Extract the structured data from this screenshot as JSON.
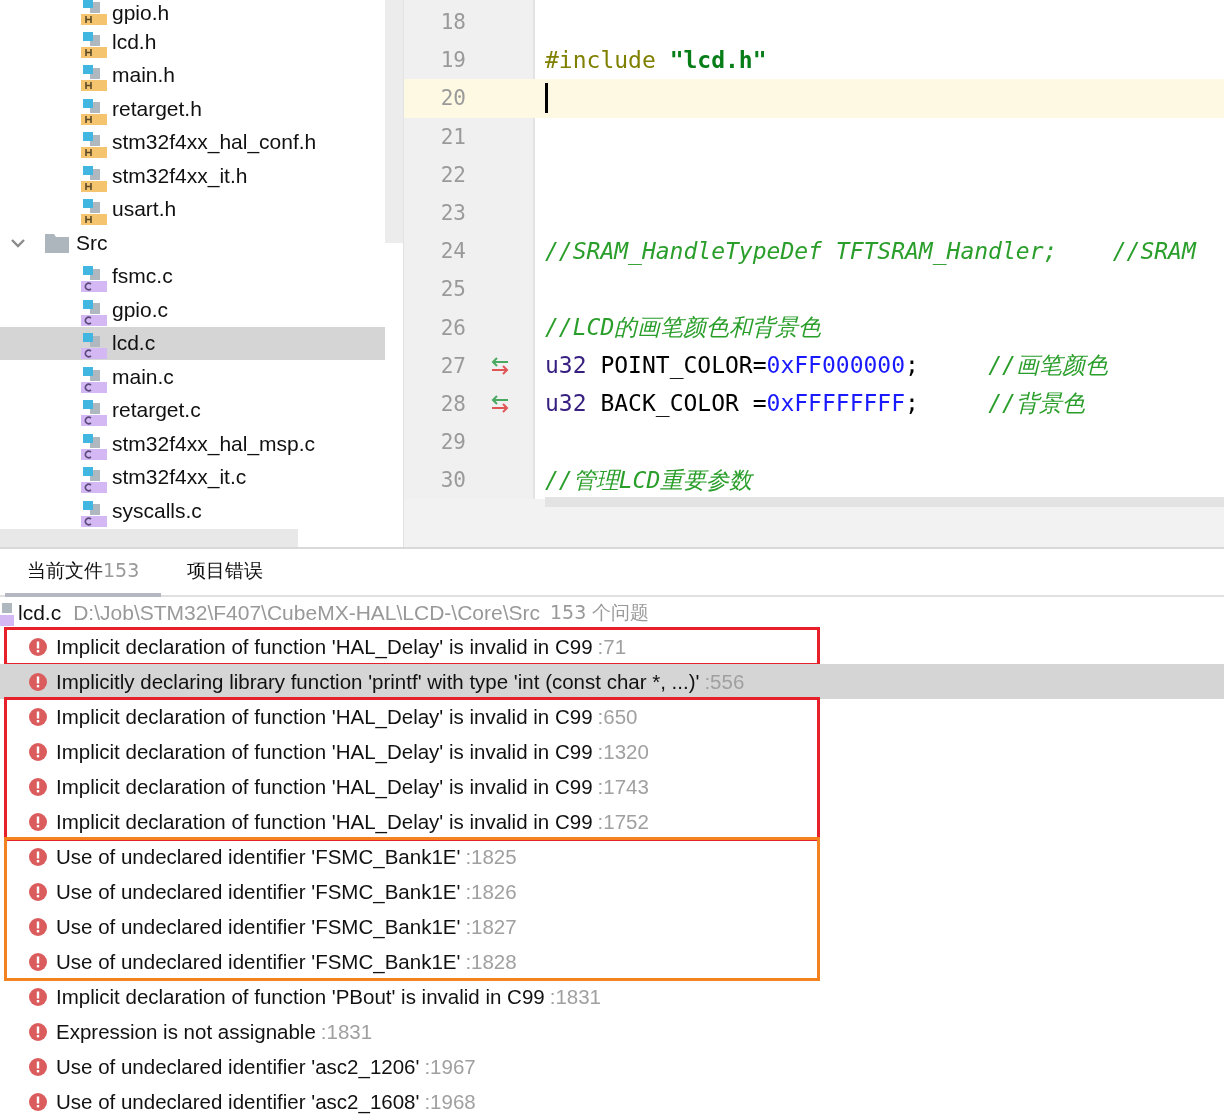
{
  "file_tree": {
    "items": [
      {
        "name": "gpio.h",
        "kind": "header",
        "selected": false
      },
      {
        "name": "lcd.h",
        "kind": "header",
        "selected": false
      },
      {
        "name": "main.h",
        "kind": "header",
        "selected": false
      },
      {
        "name": "retarget.h",
        "kind": "header",
        "selected": false
      },
      {
        "name": "stm32f4xx_hal_conf.h",
        "kind": "header",
        "selected": false
      },
      {
        "name": "stm32f4xx_it.h",
        "kind": "header",
        "selected": false
      },
      {
        "name": "usart.h",
        "kind": "header",
        "selected": false
      },
      {
        "name": "Src",
        "kind": "folder",
        "expanded": true,
        "selected": false,
        "children": [
          {
            "name": "fsmc.c",
            "kind": "source",
            "selected": false
          },
          {
            "name": "gpio.c",
            "kind": "source",
            "selected": false
          },
          {
            "name": "lcd.c",
            "kind": "source",
            "selected": true
          },
          {
            "name": "main.c",
            "kind": "source",
            "selected": false
          },
          {
            "name": "retarget.c",
            "kind": "source",
            "selected": false
          },
          {
            "name": "stm32f4xx_hal_msp.c",
            "kind": "source",
            "selected": false
          },
          {
            "name": "stm32f4xx_it.c",
            "kind": "source",
            "selected": false
          },
          {
            "name": "syscalls.c",
            "kind": "source",
            "selected": false
          }
        ]
      }
    ]
  },
  "editor": {
    "lines": [
      {
        "number": "18",
        "current": false,
        "changed": false
      },
      {
        "number": "19",
        "current": false,
        "changed": false,
        "tokens": [
          {
            "kind": "preproc",
            "text": "#include "
          },
          {
            "kind": "string",
            "text": "\"lcd.h\""
          }
        ]
      },
      {
        "number": "20",
        "current": true,
        "changed": false
      },
      {
        "number": "21",
        "current": false,
        "changed": false
      },
      {
        "number": "22",
        "current": false,
        "changed": false
      },
      {
        "number": "23",
        "current": false,
        "changed": false
      },
      {
        "number": "24",
        "current": false,
        "changed": false,
        "tokens": [
          {
            "kind": "comment",
            "text": "//SRAM_HandleTypeDef TFTSRAM_Handler;    //SRAM"
          }
        ]
      },
      {
        "number": "25",
        "current": false,
        "changed": false
      },
      {
        "number": "26",
        "current": false,
        "changed": false,
        "tokens": [
          {
            "kind": "comment",
            "text": "//LCD的画笔颜色和背景色"
          }
        ]
      },
      {
        "number": "27",
        "current": false,
        "changed": true,
        "tokens": [
          {
            "kind": "type",
            "text": "u32"
          },
          {
            "kind": "plain",
            "text": " POINT_COLOR="
          },
          {
            "kind": "number",
            "text": "0xFF000000"
          },
          {
            "kind": "plain",
            "text": ";     "
          },
          {
            "kind": "comment",
            "text": "//画笔颜色"
          }
        ]
      },
      {
        "number": "28",
        "current": false,
        "changed": true,
        "tokens": [
          {
            "kind": "type",
            "text": "u32"
          },
          {
            "kind": "plain",
            "text": " BACK_COLOR ="
          },
          {
            "kind": "number",
            "text": "0xFFFFFFFF"
          },
          {
            "kind": "plain",
            "text": ";     "
          },
          {
            "kind": "comment",
            "text": "//背景色"
          }
        ]
      },
      {
        "number": "29",
        "current": false,
        "changed": false
      },
      {
        "number": "30",
        "current": false,
        "changed": false,
        "tokens": [
          {
            "kind": "comment",
            "text": "//管理LCD重要参数"
          }
        ]
      }
    ]
  },
  "problems_panel": {
    "tabs": [
      {
        "label": "当前文件",
        "count": "153",
        "selected": true
      },
      {
        "label": "项目错误",
        "selected": false
      }
    ],
    "file": {
      "name": "lcd.c",
      "path": "D:\\Job\\STM32\\F407\\CubeMX-HAL\\LCD-\\Core\\Src",
      "summary": "153 个问题"
    },
    "groups": [
      {
        "color": "#e8202a",
        "problems": [
          {
            "message": "Implicit declaration of function 'HAL_Delay' is invalid in C99",
            "line": ":71",
            "selected": false
          }
        ]
      },
      {
        "problems": [
          {
            "message": "Implicitly declaring library function 'printf' with type 'int (const char *, ...)'",
            "line": ":556",
            "selected": true
          }
        ]
      },
      {
        "color": "#e8202a",
        "problems": [
          {
            "message": "Implicit declaration of function 'HAL_Delay' is invalid in C99",
            "line": ":650",
            "selected": false
          },
          {
            "message": "Implicit declaration of function 'HAL_Delay' is invalid in C99",
            "line": ":1320",
            "selected": false
          },
          {
            "message": "Implicit declaration of function 'HAL_Delay' is invalid in C99",
            "line": ":1743",
            "selected": false
          },
          {
            "message": "Implicit declaration of function 'HAL_Delay' is invalid in C99",
            "line": ":1752",
            "selected": false
          }
        ]
      },
      {
        "color": "#f58220",
        "problems": [
          {
            "message": "Use of undeclared identifier 'FSMC_Bank1E'",
            "line": ":1825",
            "selected": false
          },
          {
            "message": "Use of undeclared identifier 'FSMC_Bank1E'",
            "line": ":1826",
            "selected": false
          },
          {
            "message": "Use of undeclared identifier 'FSMC_Bank1E'",
            "line": ":1827",
            "selected": false
          },
          {
            "message": "Use of undeclared identifier 'FSMC_Bank1E'",
            "line": ":1828",
            "selected": false
          }
        ]
      },
      {
        "problems": [
          {
            "message": "Implicit declaration of function 'PBout' is invalid in C99",
            "line": ":1831",
            "selected": false
          },
          {
            "message": "Expression is not assignable",
            "line": ":1831",
            "selected": false
          },
          {
            "message": "Use of undeclared identifier 'asc2_1206'",
            "line": ":1967",
            "selected": false
          },
          {
            "message": "Use of undeclared identifier 'asc2_1608'",
            "line": ":1968",
            "selected": false
          }
        ]
      }
    ]
  }
}
